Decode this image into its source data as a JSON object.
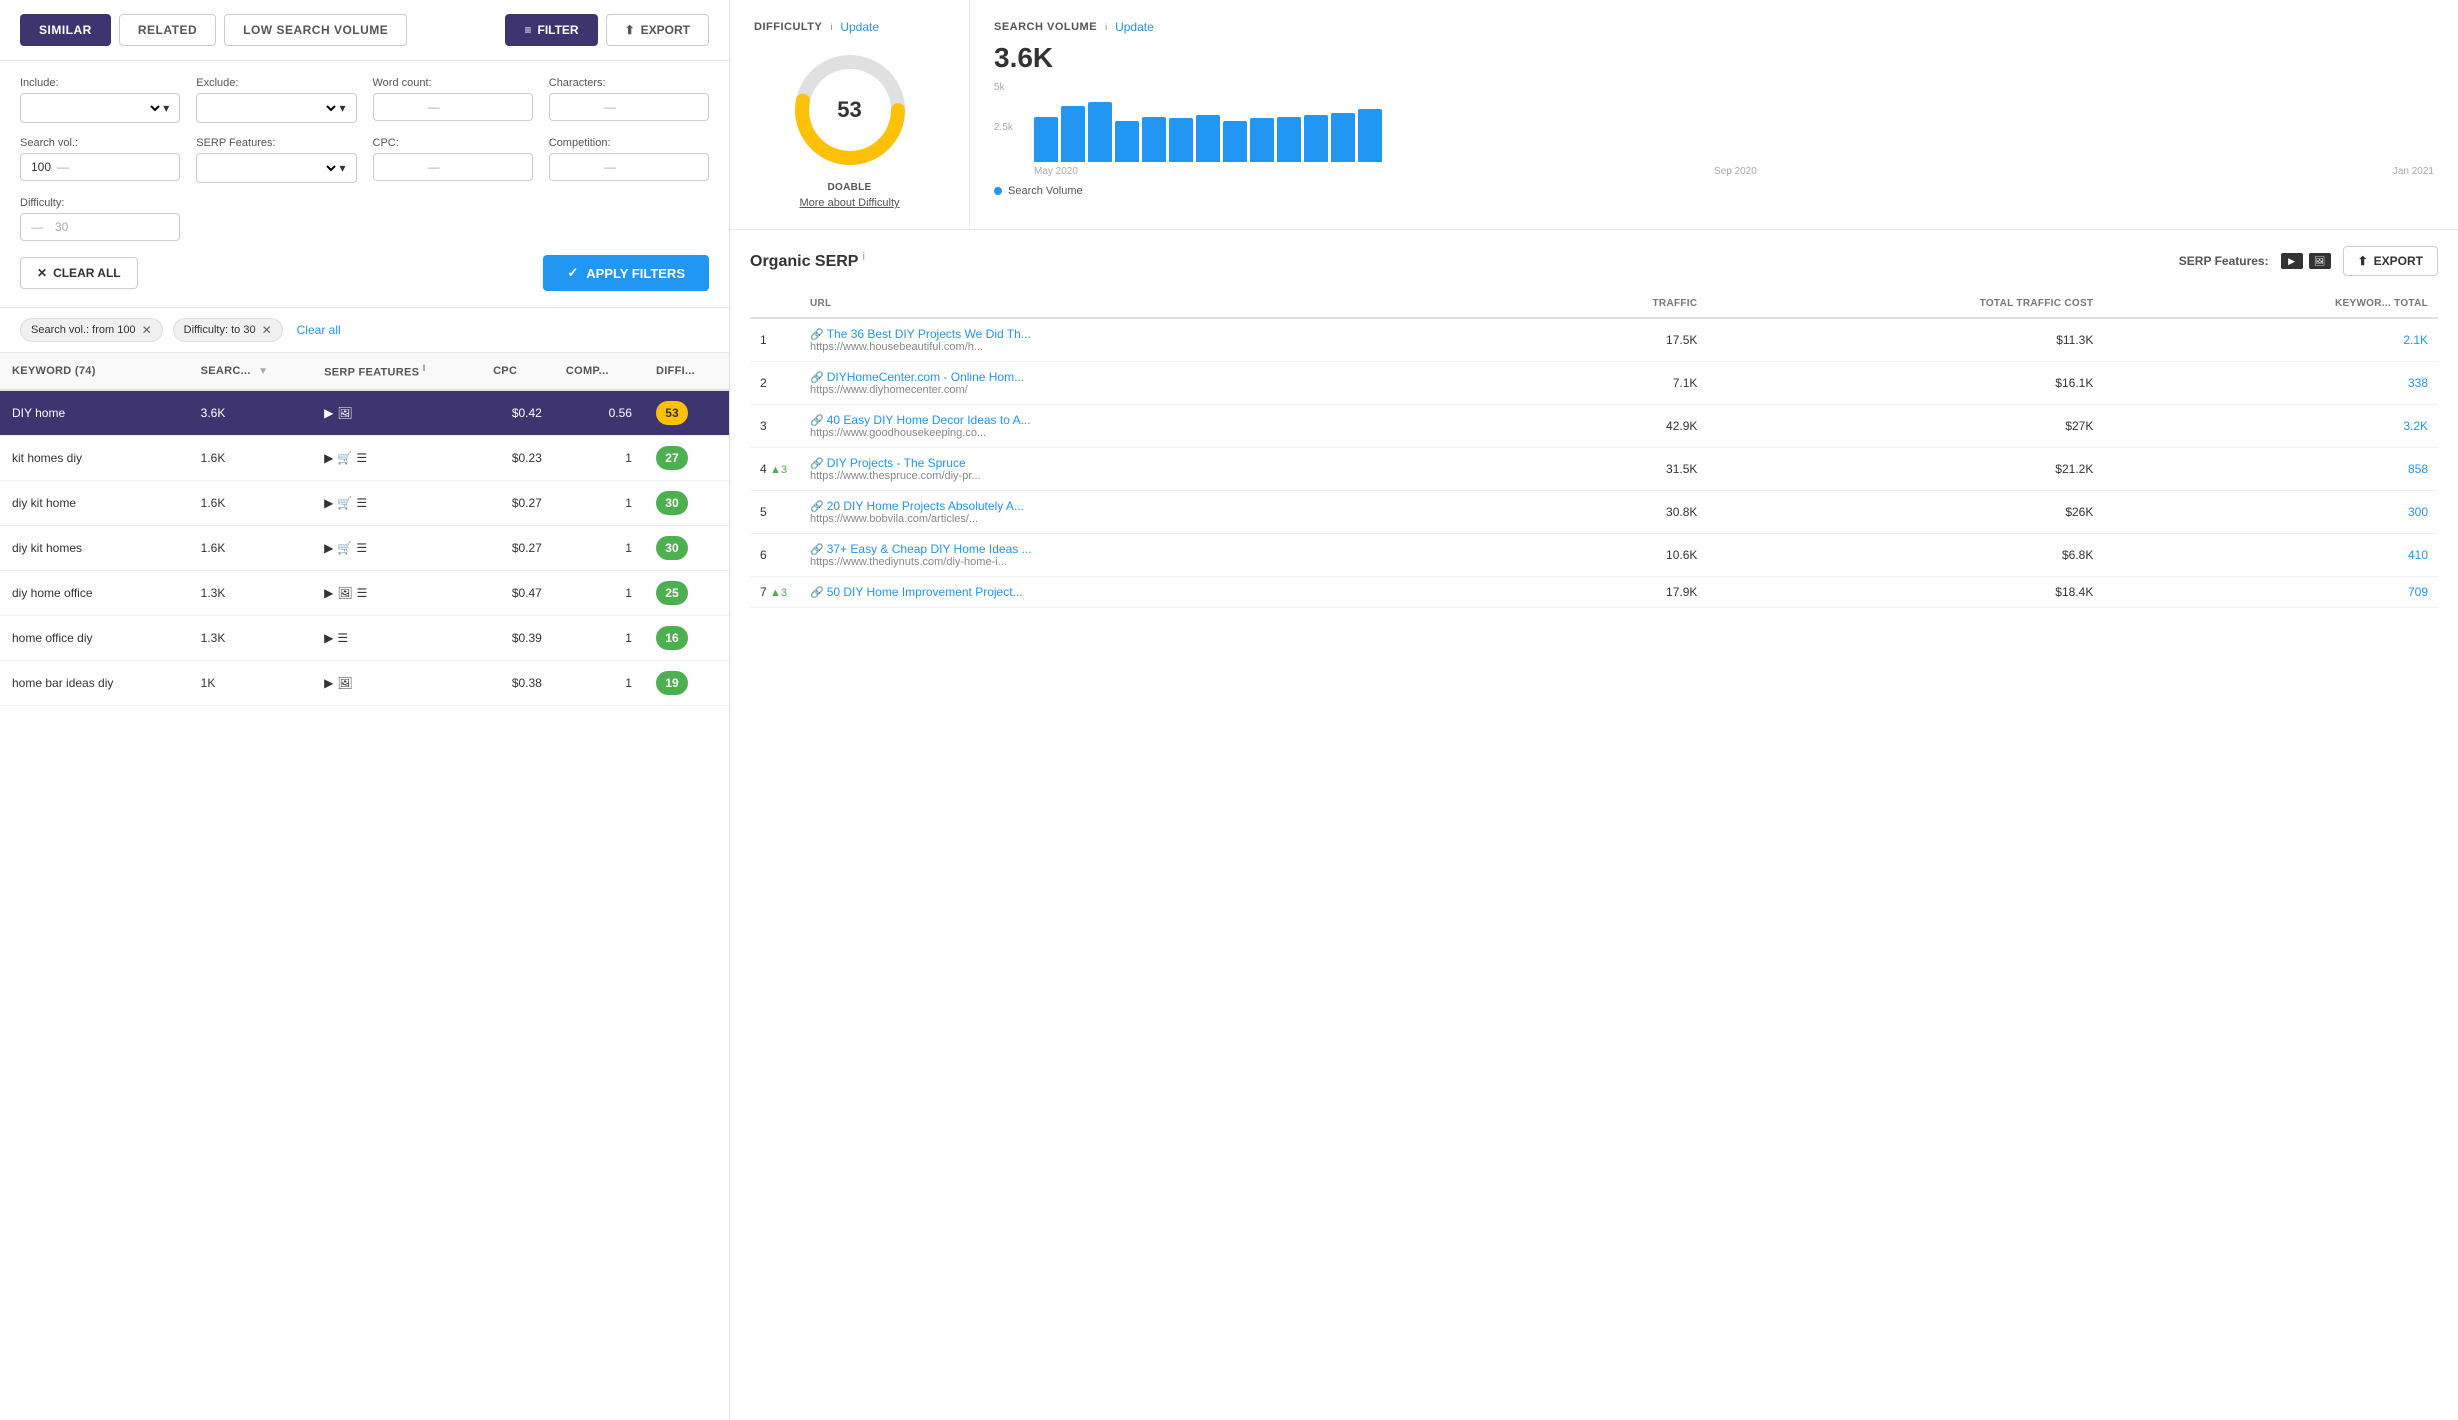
{
  "tabs": {
    "items": [
      {
        "label": "SIMILAR",
        "active": true
      },
      {
        "label": "RELATED",
        "active": false
      },
      {
        "label": "LOW SEARCH VOLUME",
        "active": false
      }
    ],
    "filter_label": "FILTER",
    "export_label": "EXPORT"
  },
  "filters": {
    "include_label": "Include:",
    "exclude_label": "Exclude:",
    "word_count_label": "Word count:",
    "characters_label": "Characters:",
    "search_vol_label": "Search vol.:",
    "search_vol_value": "100",
    "serp_features_label": "SERP Features:",
    "cpc_label": "CPC:",
    "competition_label": "Competition:",
    "difficulty_label": "Difficulty:",
    "difficulty_value": "30",
    "clear_all_label": "CLEAR ALL",
    "apply_filters_label": "APPLY FILTERS"
  },
  "active_filters": [
    {
      "label": "Search vol.: from 100",
      "key": "searchvol"
    },
    {
      "label": "Difficulty: to 30",
      "key": "difficulty"
    }
  ],
  "clear_all_link": "Clear all",
  "table": {
    "keyword_header": "KEYWORD (74)",
    "search_header": "SEARC...",
    "serp_features_header": "SERP FEATURES",
    "cpc_header": "CPC",
    "comp_header": "COMP...",
    "diff_header": "DIFFI...",
    "rows": [
      {
        "keyword": "DIY home",
        "search": "3.6K",
        "serp": [
          "video",
          "image"
        ],
        "cpc": "$0.42",
        "comp": "0.56",
        "diff": 53,
        "diff_color": "yellow"
      },
      {
        "keyword": "kit homes diy",
        "search": "1.6K",
        "serp": [
          "video",
          "cart",
          "list"
        ],
        "cpc": "$0.23",
        "comp": "1",
        "diff": 27,
        "diff_color": "green"
      },
      {
        "keyword": "diy kit home",
        "search": "1.6K",
        "serp": [
          "video",
          "cart",
          "list"
        ],
        "cpc": "$0.27",
        "comp": "1",
        "diff": 30,
        "diff_color": "green"
      },
      {
        "keyword": "diy kit homes",
        "search": "1.6K",
        "serp": [
          "video",
          "cart",
          "list"
        ],
        "cpc": "$0.27",
        "comp": "1",
        "diff": 30,
        "diff_color": "green"
      },
      {
        "keyword": "diy home office",
        "search": "1.3K",
        "serp": [
          "video",
          "image",
          "list"
        ],
        "cpc": "$0.47",
        "comp": "1",
        "diff": 25,
        "diff_color": "green"
      },
      {
        "keyword": "home office diy",
        "search": "1.3K",
        "serp": [
          "video",
          "list"
        ],
        "cpc": "$0.39",
        "comp": "1",
        "diff": 16,
        "diff_color": "green"
      },
      {
        "keyword": "home bar ideas diy",
        "search": "1K",
        "serp": [
          "video",
          "image"
        ],
        "cpc": "$0.38",
        "comp": "1",
        "diff": 19,
        "diff_color": "green"
      }
    ]
  },
  "difficulty": {
    "title": "DIFFICULTY",
    "value": 53,
    "label": "DOABLE",
    "update_link": "Update",
    "more_about": "More about Difficulty",
    "donut_filled": 53,
    "donut_empty": 47,
    "color_filled": "#ffc107",
    "color_empty": "#e0e0e0"
  },
  "search_volume": {
    "title": "SEARCH VOLUME",
    "update_link": "Update",
    "value": "3.6K",
    "chart": {
      "y_labels": [
        "5k",
        "2.5k",
        ""
      ],
      "bars": [
        60,
        75,
        80,
        55,
        60,
        58,
        62,
        55,
        58,
        60,
        62,
        65,
        70
      ],
      "x_labels": [
        "May 2020",
        "Sep 2020",
        "Jan 2021"
      ]
    },
    "legend": "Search Volume"
  },
  "organic_serp": {
    "title": "Organic SERP",
    "serp_features_label": "SERP Features:",
    "export_label": "EXPORT",
    "columns": {
      "url": "URL",
      "traffic": "TRAFFIC",
      "total_traffic_cost": "TOTAL TRAFFIC COST",
      "keyword_total": "KEYWOR... TOTAL"
    },
    "rows": [
      {
        "rank": "1",
        "rank_change": null,
        "title": "The 36 Best DIY Projects We Did Th...",
        "url": "https://www.housebeautiful.com/h...",
        "traffic": "17.5K",
        "cost": "$11.3K",
        "keywords": "2.1K"
      },
      {
        "rank": "2",
        "rank_change": null,
        "title": "DIYHomeCenter.com - Online Hom...",
        "url": "https://www.diyhomecenter.com/",
        "traffic": "7.1K",
        "cost": "$16.1K",
        "keywords": "338"
      },
      {
        "rank": "3",
        "rank_change": null,
        "title": "40 Easy DIY Home Decor Ideas to A...",
        "url": "https://www.goodhousekeeping.co...",
        "traffic": "42.9K",
        "cost": "$27K",
        "keywords": "3.2K"
      },
      {
        "rank": "4",
        "rank_change": "▲3",
        "title": "DIY Projects - The Spruce",
        "url": "https://www.thespruce.com/diy-pr...",
        "traffic": "31.5K",
        "cost": "$21.2K",
        "keywords": "858"
      },
      {
        "rank": "5",
        "rank_change": null,
        "title": "20 DIY Home Projects Absolutely A...",
        "url": "https://www.bobvila.com/articles/...",
        "traffic": "30.8K",
        "cost": "$26K",
        "keywords": "300"
      },
      {
        "rank": "6",
        "rank_change": null,
        "title": "37+ Easy & Cheap DIY Home Ideas ...",
        "url": "https://www.thediynuts.com/diy-home-i...",
        "traffic": "10.6K",
        "cost": "$6.8K",
        "keywords": "410"
      },
      {
        "rank": "7",
        "rank_change": "▲3",
        "title": "50 DIY Home Improvement Project...",
        "url": "",
        "traffic": "17.9K",
        "cost": "$18.4K",
        "keywords": "709"
      }
    ]
  }
}
